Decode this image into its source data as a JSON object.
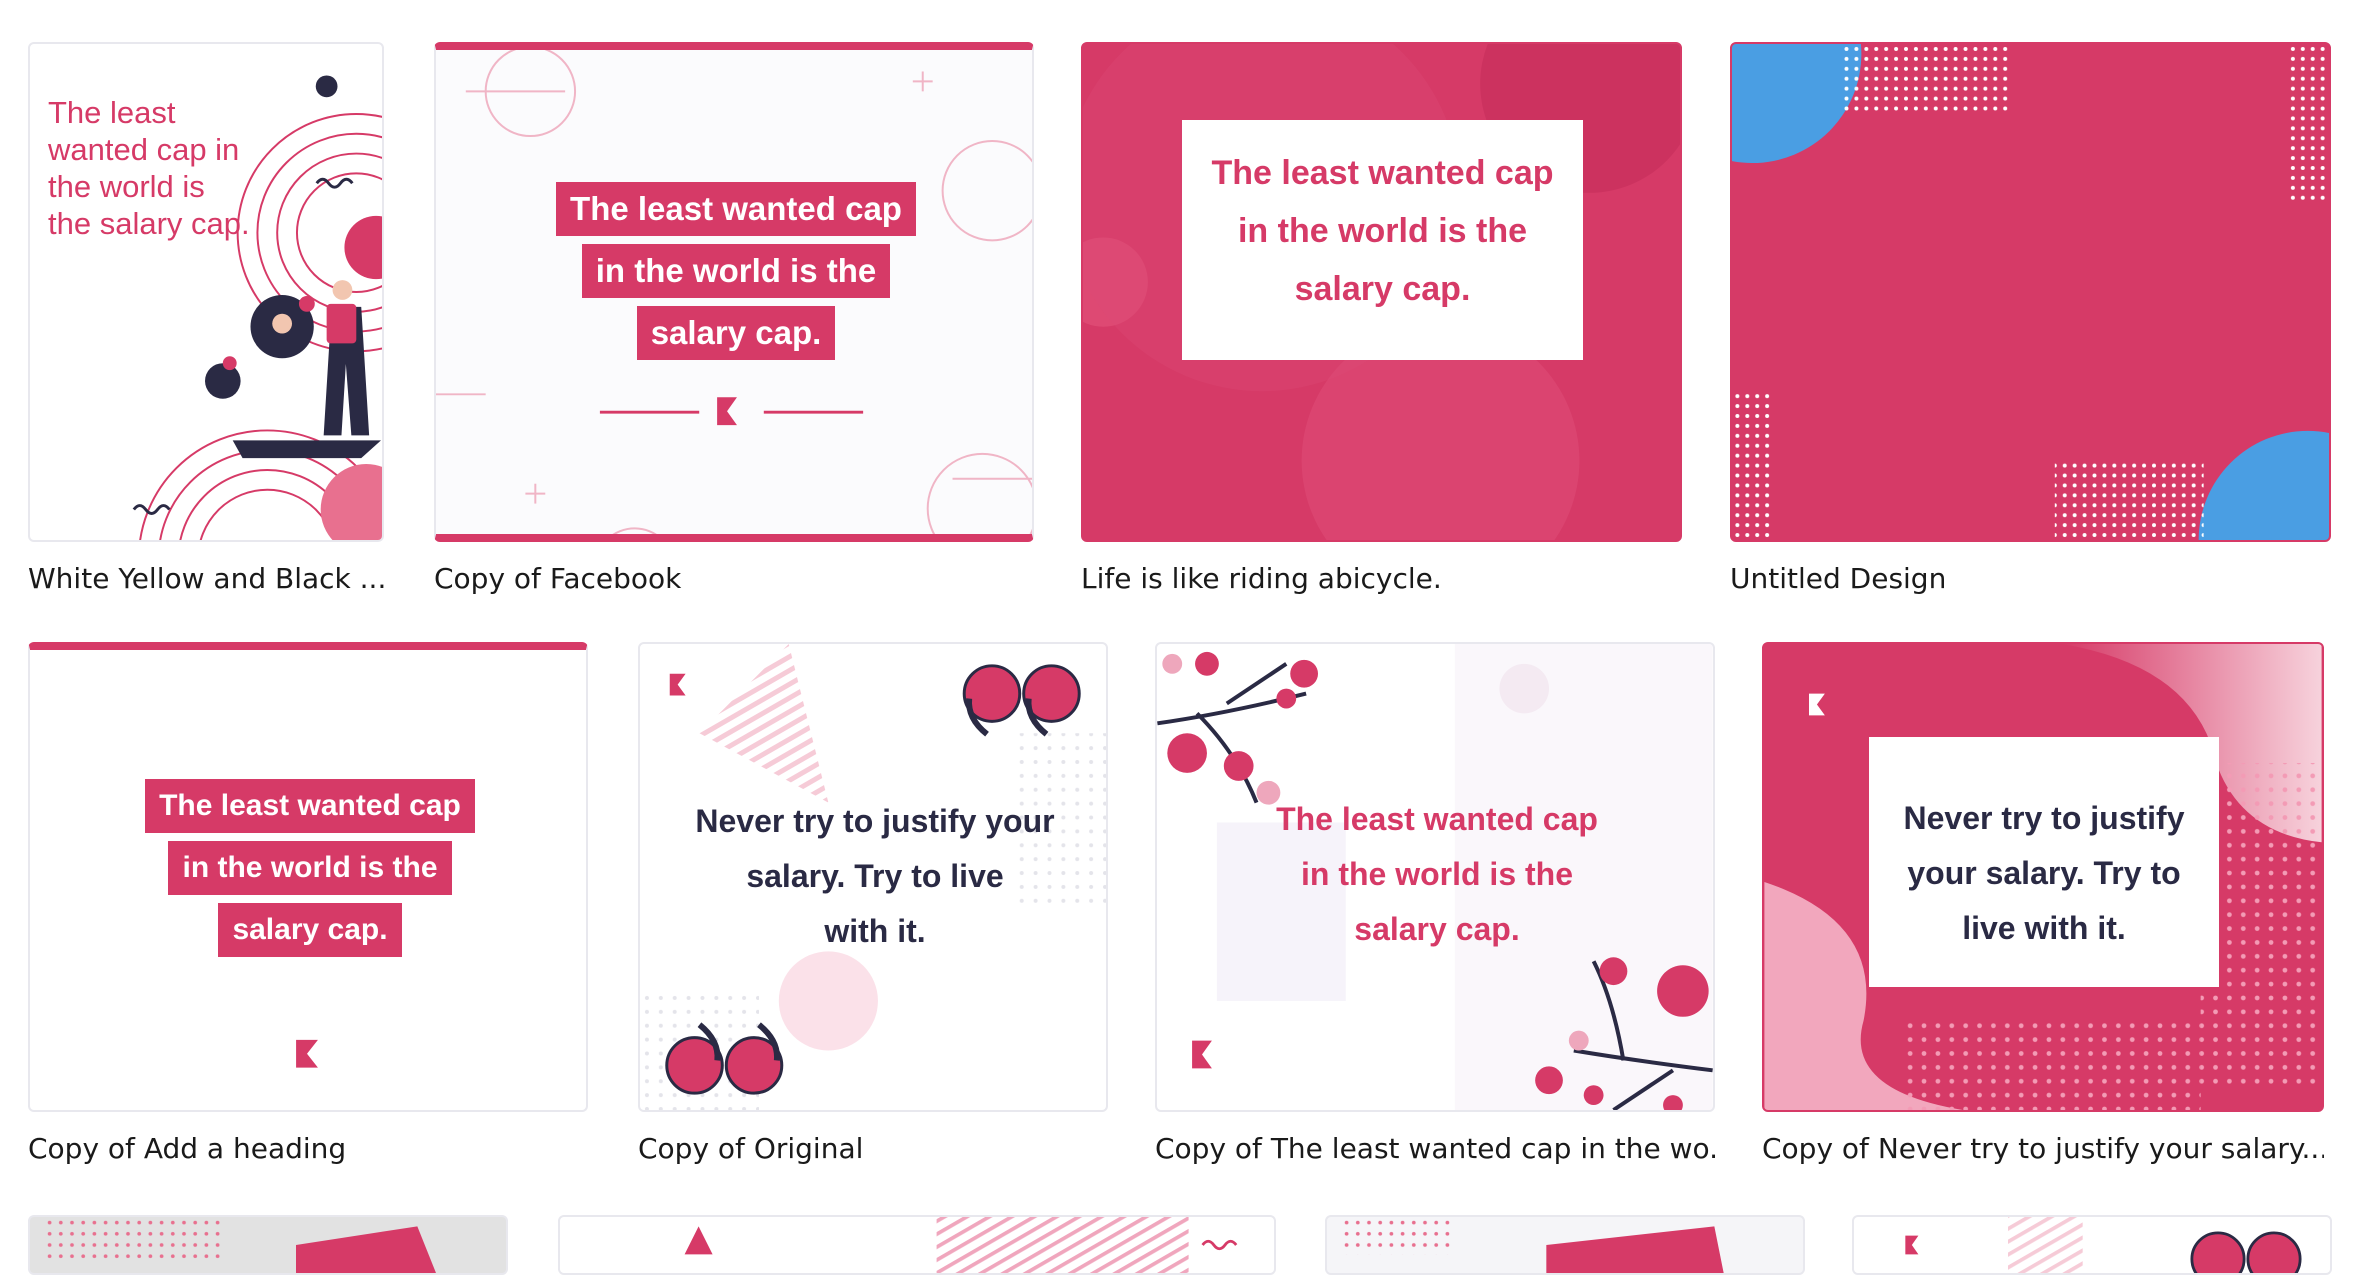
{
  "colors": {
    "brand_pink": "#d63a67",
    "navy": "#2a2a44",
    "blue": "#4a9ee3"
  },
  "designs": [
    {
      "caption": "White Yellow and Black ...",
      "text": "The least wanted cap in the world is the salary cap."
    },
    {
      "caption": "Copy of Facebook",
      "lines": [
        "The least wanted cap",
        "in the world is the",
        "salary cap."
      ]
    },
    {
      "caption": "Life is like riding abicycle.",
      "lines": [
        "The least wanted cap",
        "in the world is the",
        "salary cap."
      ]
    },
    {
      "caption": "Untitled Design"
    },
    {
      "caption": "Copy of Add a heading",
      "lines": [
        "The least wanted cap",
        "in the world is the",
        "salary cap."
      ]
    },
    {
      "caption": "Copy of Original",
      "lines": [
        "Never try to justify your",
        "salary. Try to live",
        "with it."
      ]
    },
    {
      "caption": "Copy of The least wanted cap in the wo...",
      "lines": [
        "The least wanted cap",
        "in the world is the",
        "salary cap."
      ]
    },
    {
      "caption": "Copy of Never try to justify your salary....",
      "lines": [
        "Never try to justify",
        "your salary. Try to",
        "live with it."
      ]
    }
  ]
}
